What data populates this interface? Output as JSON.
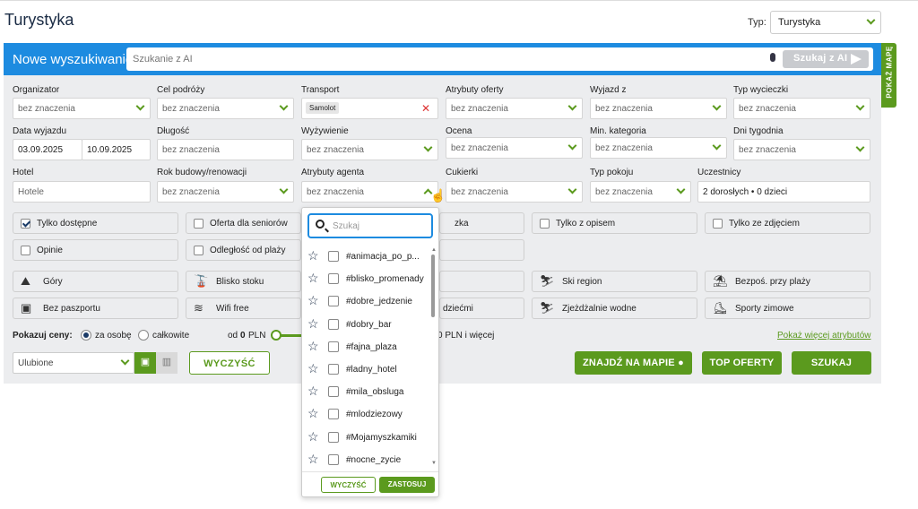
{
  "page": {
    "title": "Turystyka"
  },
  "type_select": {
    "label": "Typ:",
    "value": "Turystyka"
  },
  "search": {
    "title": "Nowe wyszukiwanie",
    "ai_placeholder": "Szukanie z AI",
    "ai_button": "Szukaj z AI",
    "map_tab": "POKAŻ MAPĘ"
  },
  "filters": {
    "organizer": {
      "label": "Organizator",
      "value": "bez znaczenia"
    },
    "destination": {
      "label": "Cel podróży",
      "value": "bez znaczenia"
    },
    "transport": {
      "label": "Transport",
      "chip": "Samolot"
    },
    "offer_attrs": {
      "label": "Atrybuty oferty",
      "value": "bez znaczenia"
    },
    "departure": {
      "label": "Wyjazd z",
      "value": "bez znaczenia"
    },
    "trip_type": {
      "label": "Typ wycieczki",
      "value": "bez znaczenia"
    },
    "dates": {
      "label": "Data wyjazdu",
      "from": "03.09.2025",
      "to": "10.09.2025"
    },
    "length": {
      "label": "Długość",
      "value": "bez znaczenia"
    },
    "board": {
      "label": "Wyżywienie",
      "value": "bez znaczenia"
    },
    "rating": {
      "label": "Ocena",
      "value": "bez znaczenia"
    },
    "min_category": {
      "label": "Min. kategoria",
      "value": "bez znaczenia"
    },
    "weekdays": {
      "label": "Dni tygodnia",
      "value": "bez znaczenia"
    },
    "hotel": {
      "label": "Hotel",
      "placeholder": "Hotele"
    },
    "build_year": {
      "label": "Rok budowy/renowacji",
      "value": "bez znaczenia"
    },
    "agent_attrs": {
      "label": "Atrybuty agenta",
      "value": "bez znaczenia"
    },
    "sweets": {
      "label": "Cukierki",
      "value": "bez znaczenia"
    },
    "room_type": {
      "label": "Typ pokoju",
      "value": "bez znaczenia"
    },
    "participants": {
      "label": "Uczestnicy",
      "value": "2 dorosłych • 0 dzieci"
    }
  },
  "checkboxes": {
    "only_available": "Tylko dostępne",
    "seniors": "Oferta dla seniorów",
    "partial": "zka",
    "with_description": "Tylko z opisem",
    "with_photo": "Tylko ze zdjęciem",
    "reviews": "Opinie",
    "beach_distance": "Odległość od plaży"
  },
  "attributes": {
    "mountains": "Góry",
    "near_slope": "Blisko stoku",
    "ski_region": "Ski region",
    "beach_direct": "Bezpoś. przy plaży",
    "no_passport": "Bez paszportu",
    "wifi": "Wifi free",
    "children": "dziećmi",
    "water_slides": "Zjeżdżalnie wodne",
    "winter_sports": "Sporty zimowe"
  },
  "price": {
    "label": "Pokazuj ceny:",
    "per_person": "za osobę",
    "total": "całkowite",
    "from_prefix": "od",
    "from_value": "0",
    "currency": "PLN",
    "to_text": "0 PLN i więcej",
    "more_link": "Pokaż więcej atrybutów"
  },
  "actions": {
    "favorites": "Ulubione",
    "clear": "WYCZYŚĆ",
    "map": "ZNAJDŹ NA MAPIE",
    "top": "TOP OFERTY",
    "search": "SZUKAJ"
  },
  "dropdown": {
    "search_placeholder": "Szukaj",
    "items": [
      "#animacja_po_p...",
      "#blisko_promenady",
      "#dobre_jedzenie",
      "#dobry_bar",
      "#fajna_plaza",
      "#ladny_hotel",
      "#mila_obsluga",
      "#mlodziezowy",
      "#Mojamyszkamiki",
      "#nocne_zycie"
    ],
    "clear": "WYCZYŚĆ",
    "apply": "ZASTOSUJ"
  },
  "colors": {
    "blue": "#1d8be0",
    "green": "#5b9a1e",
    "panel": "#ecedef"
  }
}
